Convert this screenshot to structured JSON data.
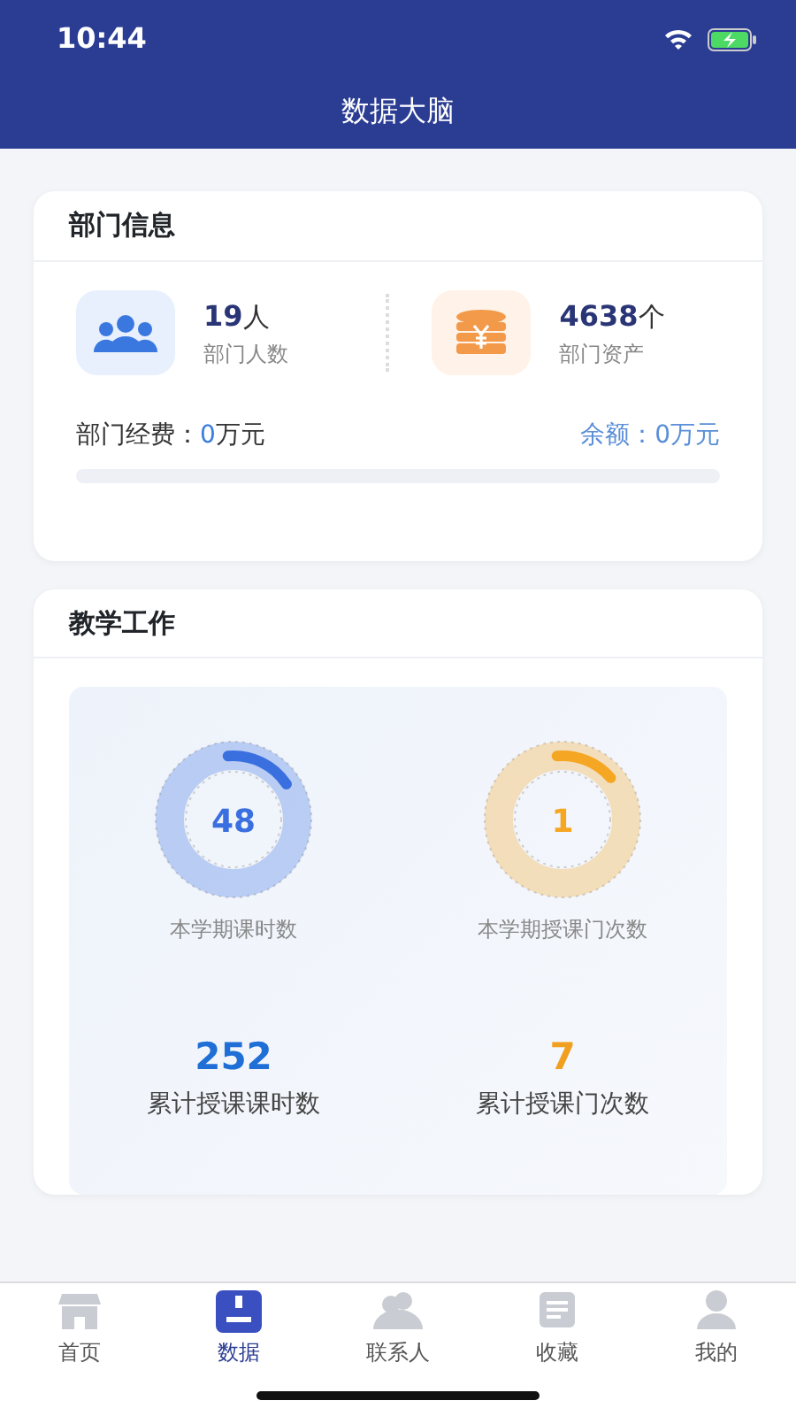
{
  "status_bar": {
    "time": "10:44"
  },
  "header": {
    "title": "数据大脑"
  },
  "department": {
    "title": "部门信息",
    "stats": [
      {
        "kind": "people",
        "value": "19",
        "unit": "人",
        "label": "部门人数"
      },
      {
        "kind": "assets",
        "value": "4638",
        "unit": "个",
        "label": "部门资产"
      }
    ],
    "budget": {
      "label": "部门经费：",
      "value": "0",
      "unit": "万元",
      "balance_label": "余额：",
      "balance": "0万元",
      "level": 0
    }
  },
  "teaching": {
    "title": "教学工作",
    "rings": [
      {
        "value": "48",
        "label": "本学期课时数",
        "level": 0.17,
        "color": "#3a6fe0"
      },
      {
        "value": "1",
        "label": "本学期授课门次数",
        "level": 0.15,
        "color": "#f5a623"
      }
    ],
    "totals": [
      {
        "value": "252",
        "label": "累计授课课时数",
        "color": "#1f6fd6"
      },
      {
        "value": "7",
        "label": "累计授课门次数",
        "color": "#f0a01e"
      }
    ]
  },
  "tabs": [
    {
      "kind": "home",
      "label": "首页",
      "selected": false
    },
    {
      "kind": "data",
      "label": "数据",
      "selected": true
    },
    {
      "kind": "contacts",
      "label": "联系人",
      "selected": false
    },
    {
      "kind": "doc",
      "label": "收藏",
      "selected": false
    },
    {
      "kind": "me",
      "label": "我的",
      "selected": false
    }
  ]
}
